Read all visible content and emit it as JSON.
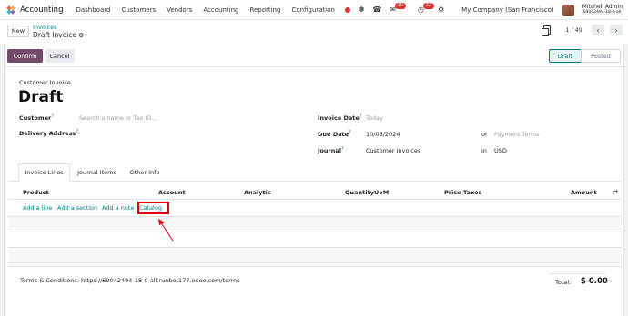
{
  "navbar": {
    "brand": "Accounting",
    "menu": [
      "Dashboard",
      "Customers",
      "Vendors",
      "Accounting",
      "Reporting",
      "Configuration"
    ],
    "badges": {
      "chat": "10",
      "activity": "22"
    },
    "company": "My Company (San Francisco)",
    "user_name": "Mitchell Admin",
    "user_db": "69042494-18-0-all"
  },
  "control_panel": {
    "new_label": "New",
    "breadcrumb_parent": "Invoices",
    "breadcrumb_current": "Draft Invoice",
    "pager": "1 / 49"
  },
  "statusbar": {
    "confirm_label": "Confirm",
    "cancel_label": "Cancel",
    "stages": [
      "Draft",
      "Posted"
    ],
    "active_stage": "Draft"
  },
  "form": {
    "type_label": "Customer Invoice",
    "name": "Draft",
    "customer_label": "Customer",
    "customer_placeholder": "Search a name or Tax ID...",
    "delivery_label": "Delivery Address",
    "invoice_date_label": "Invoice Date",
    "invoice_date_placeholder": "Today",
    "due_date_label": "Due Date",
    "due_date_value": "10/03/2024",
    "or_label": "or",
    "payment_terms_placeholder": "Payment Terms",
    "journal_label": "Journal",
    "journal_value": "Customer Invoices",
    "in_label": "in",
    "currency": "USD"
  },
  "tabs": [
    "Invoice Lines",
    "Journal Items",
    "Other Info"
  ],
  "table": {
    "headers": [
      "Product",
      "Account",
      "Analytic",
      "Quantity",
      "UoM",
      "Price",
      "Taxes",
      "Amount"
    ],
    "add_links": [
      "Add a line",
      "Add a section",
      "Add a note",
      "Catalog"
    ]
  },
  "footer": {
    "terms": "Terms & Conditions: https://69042494-18-0-all.runbot177.odoo.com/terms",
    "total_label": "Total:",
    "total_value": "$ 0.00"
  },
  "colors": {
    "brand": "#714b67",
    "link": "#017e84",
    "highlight": "#e0000f"
  },
  "icons": [
    "apps-icon",
    "bug-icon",
    "phone-icon",
    "chat-icon",
    "clock-icon",
    "gear-icon",
    "sort-icon"
  ]
}
